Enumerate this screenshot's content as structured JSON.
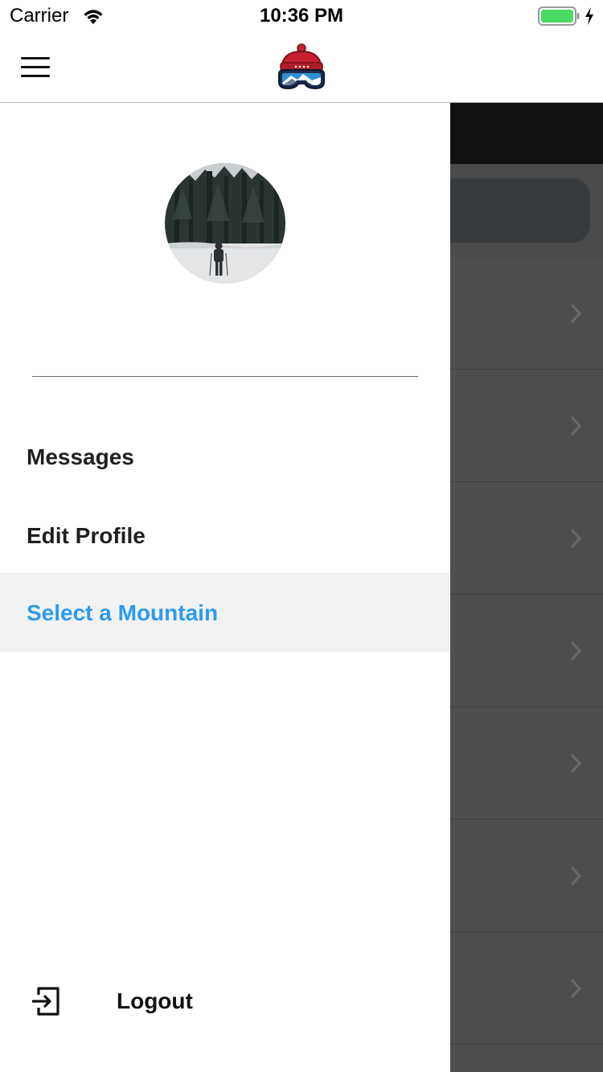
{
  "status_bar": {
    "carrier": "Carrier",
    "time": "10:36 PM",
    "battery_color": "#4cd964"
  },
  "nav": {
    "menu_icon": "hamburger-menu-icon",
    "logo_icon": "ski-beanie-goggles-logo",
    "brand_red": "#c8202f",
    "brand_blue": "#2e8fd6"
  },
  "drawer": {
    "avatar_icon": "profile-photo-skier-in-snowy-forest",
    "items": [
      {
        "label": "Messages",
        "selected": false
      },
      {
        "label": "Edit Profile",
        "selected": false
      },
      {
        "label": "Select a Mountain",
        "selected": true
      }
    ],
    "selected_color": "#2d9bf0",
    "logout": {
      "label": "Logout",
      "icon": "logout-exit-icon"
    }
  },
  "background_screen": {
    "row_count": 7,
    "row_icon": "chevron-right-icon"
  }
}
